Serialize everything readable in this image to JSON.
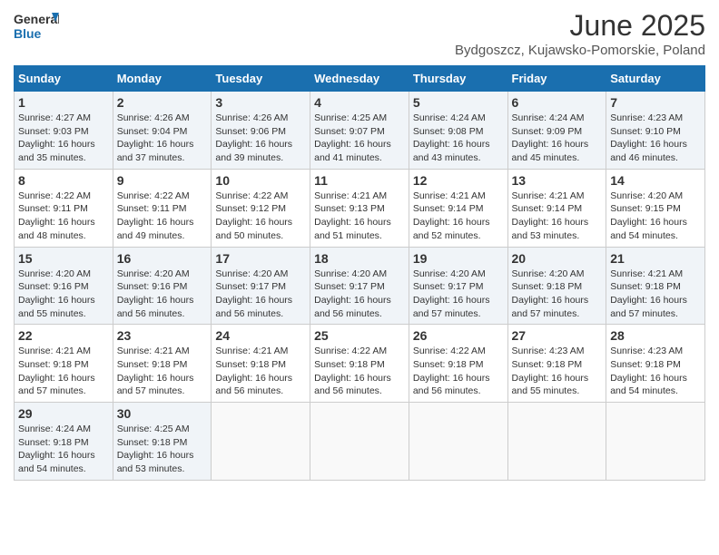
{
  "header": {
    "logo_line1": "General",
    "logo_line2": "Blue",
    "title": "June 2025",
    "subtitle": "Bydgoszcz, Kujawsko-Pomorskie, Poland"
  },
  "weekdays": [
    "Sunday",
    "Monday",
    "Tuesday",
    "Wednesday",
    "Thursday",
    "Friday",
    "Saturday"
  ],
  "weeks": [
    [
      {
        "day": 1,
        "detail": "Sunrise: 4:27 AM\nSunset: 9:03 PM\nDaylight: 16 hours and 35 minutes."
      },
      {
        "day": 2,
        "detail": "Sunrise: 4:26 AM\nSunset: 9:04 PM\nDaylight: 16 hours and 37 minutes."
      },
      {
        "day": 3,
        "detail": "Sunrise: 4:26 AM\nSunset: 9:06 PM\nDaylight: 16 hours and 39 minutes."
      },
      {
        "day": 4,
        "detail": "Sunrise: 4:25 AM\nSunset: 9:07 PM\nDaylight: 16 hours and 41 minutes."
      },
      {
        "day": 5,
        "detail": "Sunrise: 4:24 AM\nSunset: 9:08 PM\nDaylight: 16 hours and 43 minutes."
      },
      {
        "day": 6,
        "detail": "Sunrise: 4:24 AM\nSunset: 9:09 PM\nDaylight: 16 hours and 45 minutes."
      },
      {
        "day": 7,
        "detail": "Sunrise: 4:23 AM\nSunset: 9:10 PM\nDaylight: 16 hours and 46 minutes."
      }
    ],
    [
      {
        "day": 8,
        "detail": "Sunrise: 4:22 AM\nSunset: 9:11 PM\nDaylight: 16 hours and 48 minutes."
      },
      {
        "day": 9,
        "detail": "Sunrise: 4:22 AM\nSunset: 9:11 PM\nDaylight: 16 hours and 49 minutes."
      },
      {
        "day": 10,
        "detail": "Sunrise: 4:22 AM\nSunset: 9:12 PM\nDaylight: 16 hours and 50 minutes."
      },
      {
        "day": 11,
        "detail": "Sunrise: 4:21 AM\nSunset: 9:13 PM\nDaylight: 16 hours and 51 minutes."
      },
      {
        "day": 12,
        "detail": "Sunrise: 4:21 AM\nSunset: 9:14 PM\nDaylight: 16 hours and 52 minutes."
      },
      {
        "day": 13,
        "detail": "Sunrise: 4:21 AM\nSunset: 9:14 PM\nDaylight: 16 hours and 53 minutes."
      },
      {
        "day": 14,
        "detail": "Sunrise: 4:20 AM\nSunset: 9:15 PM\nDaylight: 16 hours and 54 minutes."
      }
    ],
    [
      {
        "day": 15,
        "detail": "Sunrise: 4:20 AM\nSunset: 9:16 PM\nDaylight: 16 hours and 55 minutes."
      },
      {
        "day": 16,
        "detail": "Sunrise: 4:20 AM\nSunset: 9:16 PM\nDaylight: 16 hours and 56 minutes."
      },
      {
        "day": 17,
        "detail": "Sunrise: 4:20 AM\nSunset: 9:17 PM\nDaylight: 16 hours and 56 minutes."
      },
      {
        "day": 18,
        "detail": "Sunrise: 4:20 AM\nSunset: 9:17 PM\nDaylight: 16 hours and 56 minutes."
      },
      {
        "day": 19,
        "detail": "Sunrise: 4:20 AM\nSunset: 9:17 PM\nDaylight: 16 hours and 57 minutes."
      },
      {
        "day": 20,
        "detail": "Sunrise: 4:20 AM\nSunset: 9:18 PM\nDaylight: 16 hours and 57 minutes."
      },
      {
        "day": 21,
        "detail": "Sunrise: 4:21 AM\nSunset: 9:18 PM\nDaylight: 16 hours and 57 minutes."
      }
    ],
    [
      {
        "day": 22,
        "detail": "Sunrise: 4:21 AM\nSunset: 9:18 PM\nDaylight: 16 hours and 57 minutes."
      },
      {
        "day": 23,
        "detail": "Sunrise: 4:21 AM\nSunset: 9:18 PM\nDaylight: 16 hours and 57 minutes."
      },
      {
        "day": 24,
        "detail": "Sunrise: 4:21 AM\nSunset: 9:18 PM\nDaylight: 16 hours and 56 minutes."
      },
      {
        "day": 25,
        "detail": "Sunrise: 4:22 AM\nSunset: 9:18 PM\nDaylight: 16 hours and 56 minutes."
      },
      {
        "day": 26,
        "detail": "Sunrise: 4:22 AM\nSunset: 9:18 PM\nDaylight: 16 hours and 56 minutes."
      },
      {
        "day": 27,
        "detail": "Sunrise: 4:23 AM\nSunset: 9:18 PM\nDaylight: 16 hours and 55 minutes."
      },
      {
        "day": 28,
        "detail": "Sunrise: 4:23 AM\nSunset: 9:18 PM\nDaylight: 16 hours and 54 minutes."
      }
    ],
    [
      {
        "day": 29,
        "detail": "Sunrise: 4:24 AM\nSunset: 9:18 PM\nDaylight: 16 hours and 54 minutes."
      },
      {
        "day": 30,
        "detail": "Sunrise: 4:25 AM\nSunset: 9:18 PM\nDaylight: 16 hours and 53 minutes."
      },
      null,
      null,
      null,
      null,
      null
    ]
  ]
}
